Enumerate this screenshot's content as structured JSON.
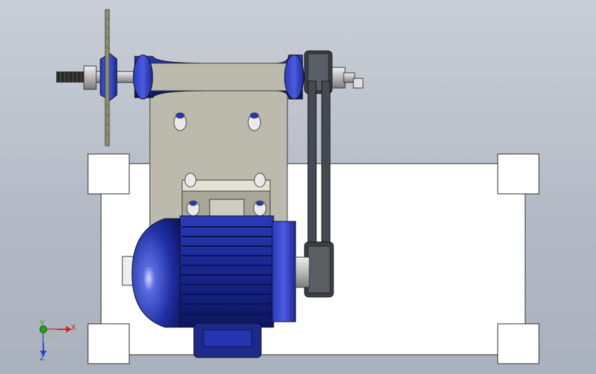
{
  "viewport": {
    "background_top": "#c9ced6",
    "background_bottom": "#a9b1bd"
  },
  "triad": {
    "x_label": "X",
    "y_label": "Y",
    "z_label": "Z",
    "x_color": "#d42020",
    "y_color": "#1fa21f",
    "z_color": "#2a3fd0"
  },
  "colors": {
    "motor_blue": "#1e2fa3",
    "frame_white": "#ffffff",
    "plate_grey": "#bfbdb0",
    "belt_dark": "#3c4046"
  }
}
